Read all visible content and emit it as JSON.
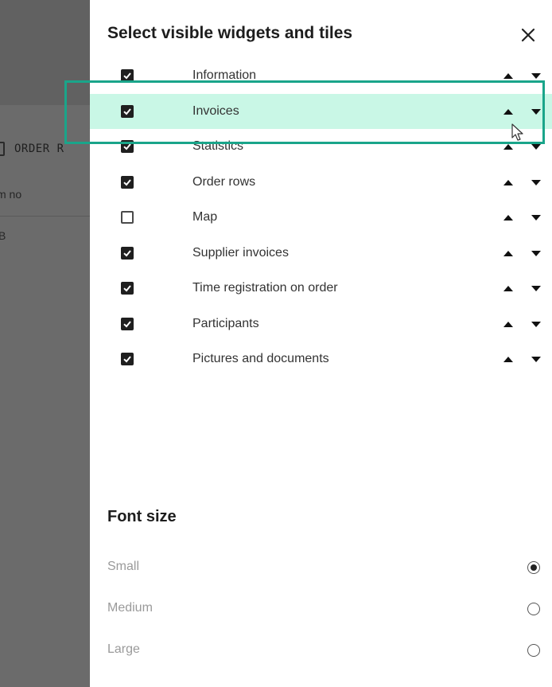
{
  "background": {
    "tab_label": "ORDER R",
    "column_header": "m no",
    "cell_value": "B"
  },
  "panel": {
    "title": "Select visible widgets and tiles",
    "close_icon": "close-icon",
    "widgets": [
      {
        "label": "Information",
        "checked": true
      },
      {
        "label": "Invoices",
        "checked": true,
        "highlighted": true
      },
      {
        "label": "Statistics",
        "checked": true
      },
      {
        "label": "Order rows",
        "checked": true
      },
      {
        "label": "Map",
        "checked": false
      },
      {
        "label": "Supplier invoices",
        "checked": true
      },
      {
        "label": "Time registration on order",
        "checked": true
      },
      {
        "label": "Participants",
        "checked": true
      },
      {
        "label": "Pictures and documents",
        "checked": true
      }
    ]
  },
  "font_size": {
    "title": "Font size",
    "options": [
      {
        "label": "Small",
        "selected": true
      },
      {
        "label": "Medium",
        "selected": false
      },
      {
        "label": "Large",
        "selected": false
      }
    ]
  },
  "colors": {
    "highlight": "#c9f7e6",
    "focus_border": "#1aa58a",
    "overlay": "#6b6b6b"
  }
}
